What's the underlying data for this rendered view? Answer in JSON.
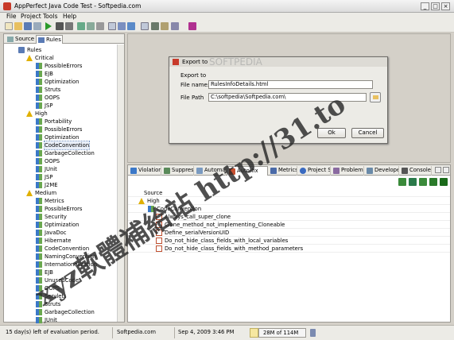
{
  "window": {
    "title": "AppPerfect Java Code Test - Softpedia.com",
    "controls": [
      "_",
      "□",
      "×"
    ]
  },
  "menu": [
    "File",
    "Project",
    "Tools",
    "Help"
  ],
  "left_tabs": [
    "Source",
    "Rules"
  ],
  "rules_tree": {
    "root": "Rules",
    "groups": [
      {
        "label": "Critical",
        "items": [
          "PossibleErrors",
          "EJB",
          "Optimization",
          "Struts",
          "OOPS",
          "JSP"
        ]
      },
      {
        "label": "High",
        "items": [
          "Portability",
          "PossibleErrors",
          "Optimization",
          "CodeConvention",
          "GarbageCollection",
          "OOPS",
          "JUnit",
          "JSP",
          "J2ME"
        ]
      },
      {
        "label": "Medium",
        "items": [
          "Metrics",
          "PossibleErrors",
          "Security",
          "Optimization",
          "JavaDoc",
          "Hibernate",
          "CodeConvention",
          "NamingConvention",
          "Internationalization",
          "EJB",
          "UnusedCode",
          "OOPS",
          "Servlets",
          "Struts",
          "GarbageCollection",
          "JUnit"
        ]
      }
    ]
  },
  "dialog": {
    "title": "Export to",
    "heading": "Export to",
    "file_name_label": "File name:",
    "file_name_value": "RulesInfoDetails.html",
    "file_path_label": "File Path",
    "file_path_value": "C:\\softpedia\\Softpedia.com\\",
    "ok": "Ok",
    "cancel": "Cancel"
  },
  "bottom_tabs": [
    "Violation",
    "Suppress",
    "Automa",
    "Auto-fix",
    "Metrics",
    "Project S",
    "Problem",
    "Develope",
    "Console"
  ],
  "results": {
    "source": "Source",
    "high": "High",
    "group": "CodeConvention",
    "items": [
      "Always_call_super_clone",
      "Clone_method_not_implementing_Cloneable",
      "Define_serialVersionUID",
      "Do_not_hide_class_fields_with_local_variables",
      "Do_not_hide_class_fields_with_method_parameters"
    ]
  },
  "status": {
    "left": "15 day(s) left of evaluation period.",
    "site": "Softpedia.com",
    "datetime": "Sep 4, 2009 3:46 PM",
    "memory": "28M of 114M"
  },
  "watermarks": {
    "main": "xyz軟體補給站 http://31.to",
    "softpedia": "SOFTPEDIA"
  },
  "colors": {
    "chrome": "#d4d0c8",
    "accent": "#3b78c8",
    "warning": "#e0b000"
  }
}
